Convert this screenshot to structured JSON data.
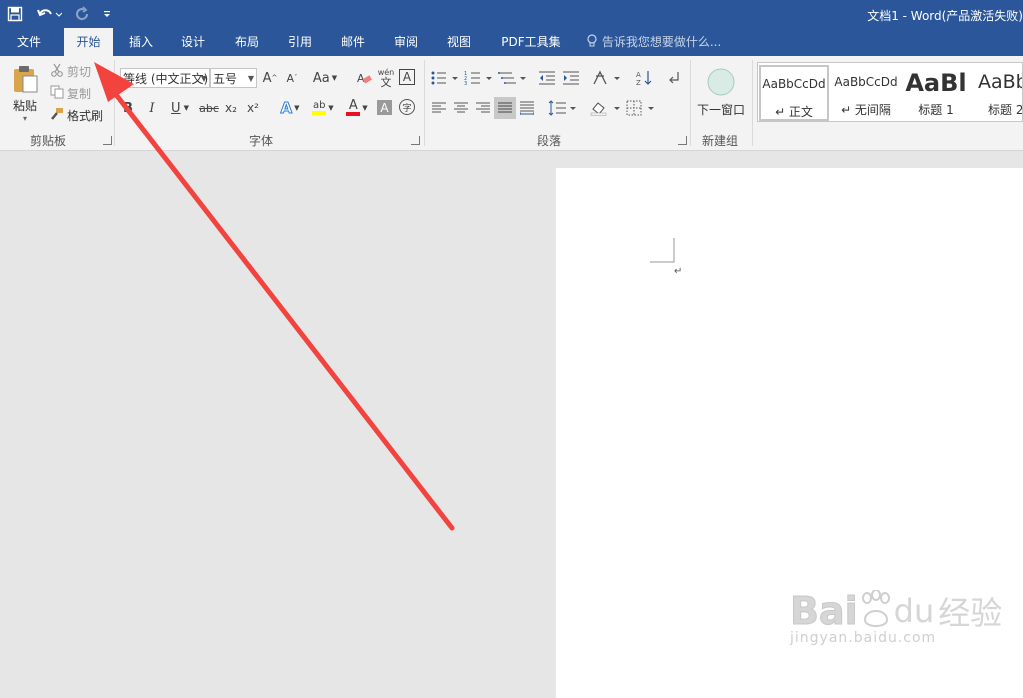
{
  "window": {
    "title": "文档1 - Word(产品激活失败)"
  },
  "quick_access": {
    "save": "save-icon",
    "undo": "undo-icon",
    "redo": "redo-icon",
    "customize": "customize-icon"
  },
  "tabs": [
    {
      "label": "文件"
    },
    {
      "label": "开始"
    },
    {
      "label": "插入"
    },
    {
      "label": "设计"
    },
    {
      "label": "布局"
    },
    {
      "label": "引用"
    },
    {
      "label": "邮件"
    },
    {
      "label": "审阅"
    },
    {
      "label": "视图"
    },
    {
      "label": "PDF工具集"
    }
  ],
  "tell_me": {
    "placeholder": "告诉我您想要做什么..."
  },
  "clipboard": {
    "paste": "粘贴",
    "cut": "剪切",
    "copy": "复制",
    "format_painter": "格式刷",
    "group": "剪贴板"
  },
  "font": {
    "name": "等线 (中文正文)",
    "size": "五号",
    "change_case": "Aa",
    "bold": "B",
    "italic": "I",
    "underline": "U",
    "strikethrough": "abc",
    "subscript": "x₂",
    "superscript": "x²",
    "phonetic_top": "wén",
    "phonetic_bottom": "文",
    "char_border": "A",
    "font_color": "A",
    "char_shading": "A",
    "enclose": "字",
    "group": "字体"
  },
  "paragraph": {
    "group": "段落"
  },
  "new_group": {
    "next_window": "下一窗口",
    "group": "新建组"
  },
  "styles": [
    {
      "sample": "AaBbCcDd",
      "name": "↵ 正文"
    },
    {
      "sample": "AaBbCcDd",
      "name": "↵ 无间隔"
    },
    {
      "sample": "AaBl",
      "name": "标题 1"
    },
    {
      "sample": "AaBb",
      "name": "标题 2"
    }
  ],
  "document": {
    "paragraph_mark": "↵"
  },
  "watermark": {
    "line1": "Bai",
    "line2": "du",
    "line3": "经验",
    "url": "jingyan.baidu.com"
  },
  "annotation": {
    "color": "#f2433f"
  },
  "colors": {
    "accent": "#2b579a",
    "font_color_bar": "#e81123",
    "highlight_bar": "#ffff00"
  }
}
